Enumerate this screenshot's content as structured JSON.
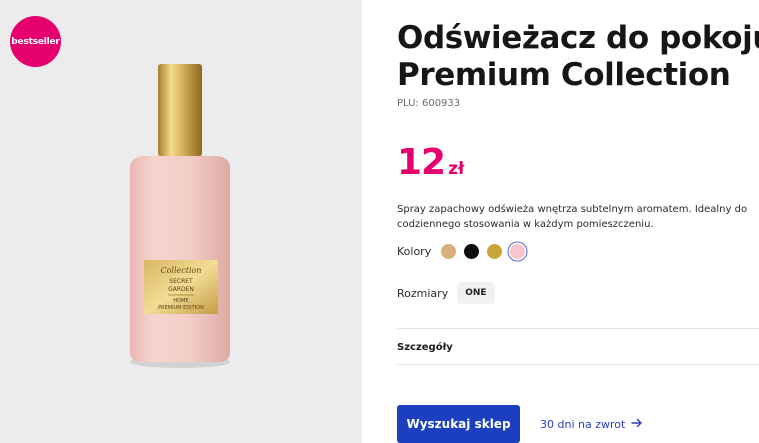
{
  "colors": {
    "accent": "#e6006d",
    "link": "#2a3fc4",
    "button": "#1c3fc0"
  },
  "product": {
    "badge": "bestseller",
    "title_line1": "Odświeżacz do pokoju",
    "title_line2": "Premium Collection",
    "plu": "PLU: 600933",
    "price_value": "12",
    "price_currency": "zł",
    "description": "Spray zapachowy odświeża wnętrza subtelnym aromatem. Idealny do codziennego stosowania w każdym pomieszczeniu."
  },
  "colors_selector": {
    "label": "Kolory",
    "swatches": [
      {
        "name": "beige",
        "hex": "#d8b07e",
        "selected": false
      },
      {
        "name": "black",
        "hex": "#0d0d0d",
        "selected": false
      },
      {
        "name": "gold",
        "hex": "#c9a43a",
        "selected": false
      },
      {
        "name": "pink",
        "hex": "#f5c6cf",
        "selected": true
      }
    ]
  },
  "sizes": {
    "label": "Rozmiary",
    "options": [
      "ONE"
    ]
  },
  "details_section": {
    "label": "Szczegóły"
  },
  "actions": {
    "find_store": "Wyszukaj sklep",
    "returns": "30 dni na zwrot"
  },
  "bottle_label": {
    "script": "Collection",
    "line1": "SECRET",
    "line2": "GARDEN",
    "line3": "HOME",
    "line4": "PREMIUM EDITION"
  }
}
